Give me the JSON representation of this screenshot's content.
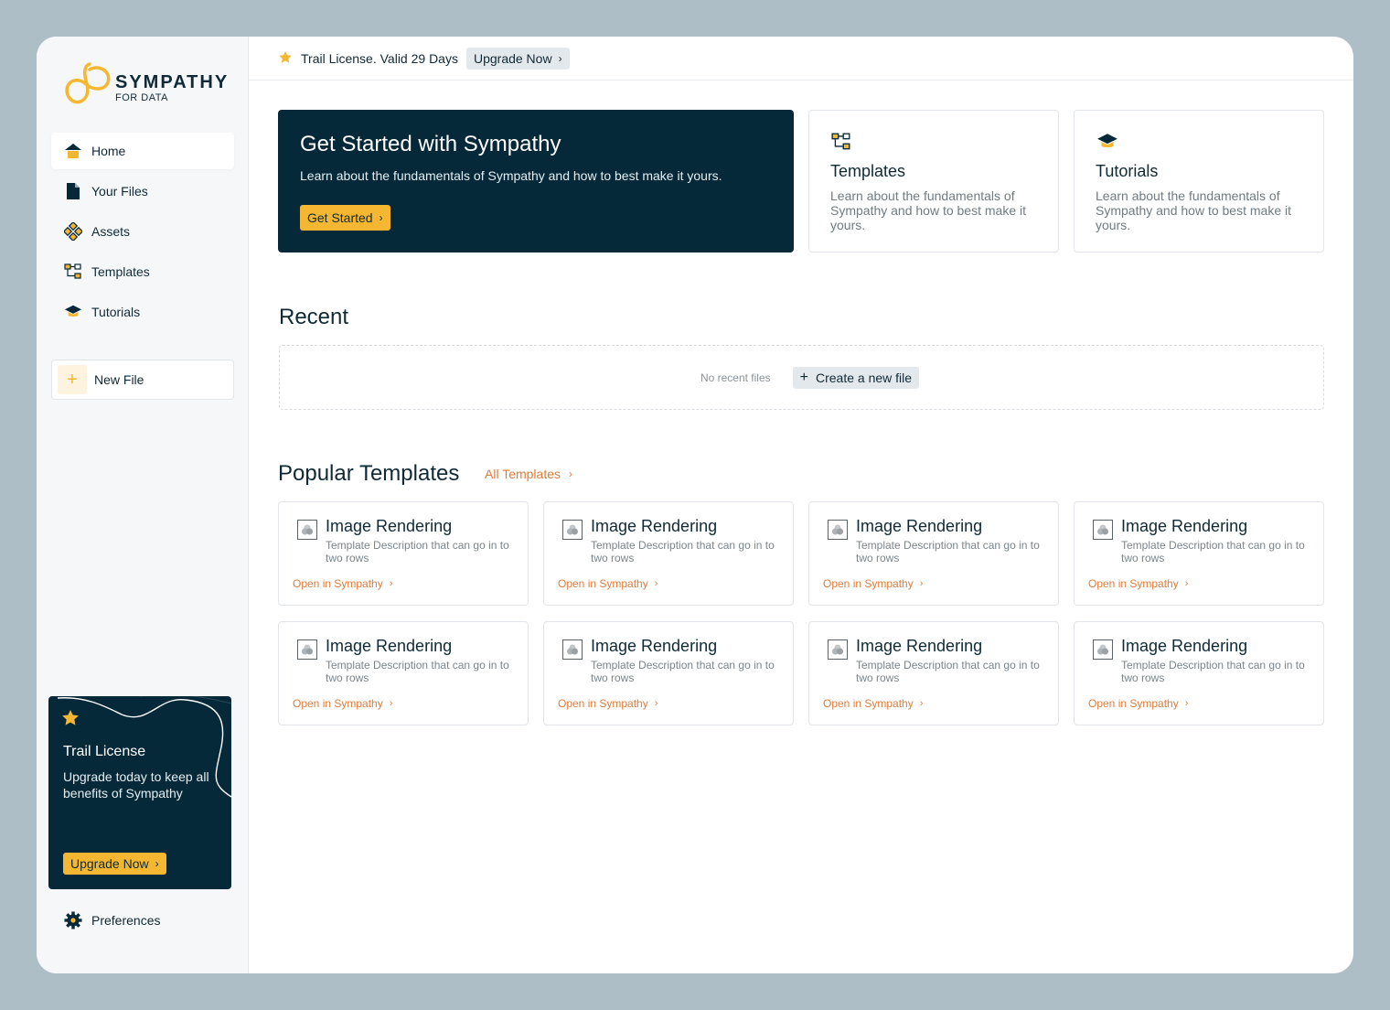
{
  "brand": {
    "name": "SYMPATHY",
    "sub": "FOR DATA",
    "accent": "#f5b731",
    "dark": "#06293a",
    "link": "#e07b39"
  },
  "sidebar": {
    "items": [
      {
        "label": "Home",
        "icon": "home-icon",
        "active": true
      },
      {
        "label": "Your Files",
        "icon": "file-icon",
        "active": false
      },
      {
        "label": "Assets",
        "icon": "assets-icon",
        "active": false
      },
      {
        "label": "Templates",
        "icon": "templates-icon",
        "active": false
      },
      {
        "label": "Tutorials",
        "icon": "graduation-cap-icon",
        "active": false
      }
    ],
    "new_file": "New File",
    "trial": {
      "title": "Trail License",
      "text": "Upgrade today to keep all benefits of Sympathy",
      "button": "Upgrade Now"
    },
    "preferences": "Preferences"
  },
  "topbar": {
    "license_text": "Trail License. Valid 29 Days",
    "upgrade_label": "Upgrade Now"
  },
  "hero": {
    "title": "Get Started with Sympathy",
    "subtitle": "Learn about the fundamentals of Sympathy and how to best make it yours.",
    "button": "Get Started"
  },
  "cards": [
    {
      "title": "Templates",
      "text": "Learn about the fundamentals of Sympathy and how to best make it yours.",
      "icon": "templates-icon"
    },
    {
      "title": "Tutorials",
      "text": "Learn about the fundamentals of Sympathy and how to best make it yours.",
      "icon": "graduation-cap-icon"
    }
  ],
  "recent": {
    "heading": "Recent",
    "empty_text": "No recent files",
    "create_label": "Create a new file"
  },
  "popular": {
    "heading": "Popular Templates",
    "all_label": "All Templates",
    "templates": [
      {
        "title": "Image Rendering",
        "desc": "Template Description that can go in to two rows",
        "link": "Open in Sympathy"
      },
      {
        "title": "Image Rendering",
        "desc": "Template Description that can go in to two rows",
        "link": "Open in Sympathy"
      },
      {
        "title": "Image Rendering",
        "desc": "Template Description that can go in to two rows",
        "link": "Open in Sympathy"
      },
      {
        "title": "Image Rendering",
        "desc": "Template Description that can go in to two rows",
        "link": "Open in Sympathy"
      },
      {
        "title": "Image Rendering",
        "desc": "Template Description that can go in to two rows",
        "link": "Open in Sympathy"
      },
      {
        "title": "Image Rendering",
        "desc": "Template Description that can go in to two rows",
        "link": "Open in Sympathy"
      },
      {
        "title": "Image Rendering",
        "desc": "Template Description that can go in to two rows",
        "link": "Open in Sympathy"
      },
      {
        "title": "Image Rendering",
        "desc": "Template Description that can go in to two rows",
        "link": "Open in Sympathy"
      }
    ]
  }
}
